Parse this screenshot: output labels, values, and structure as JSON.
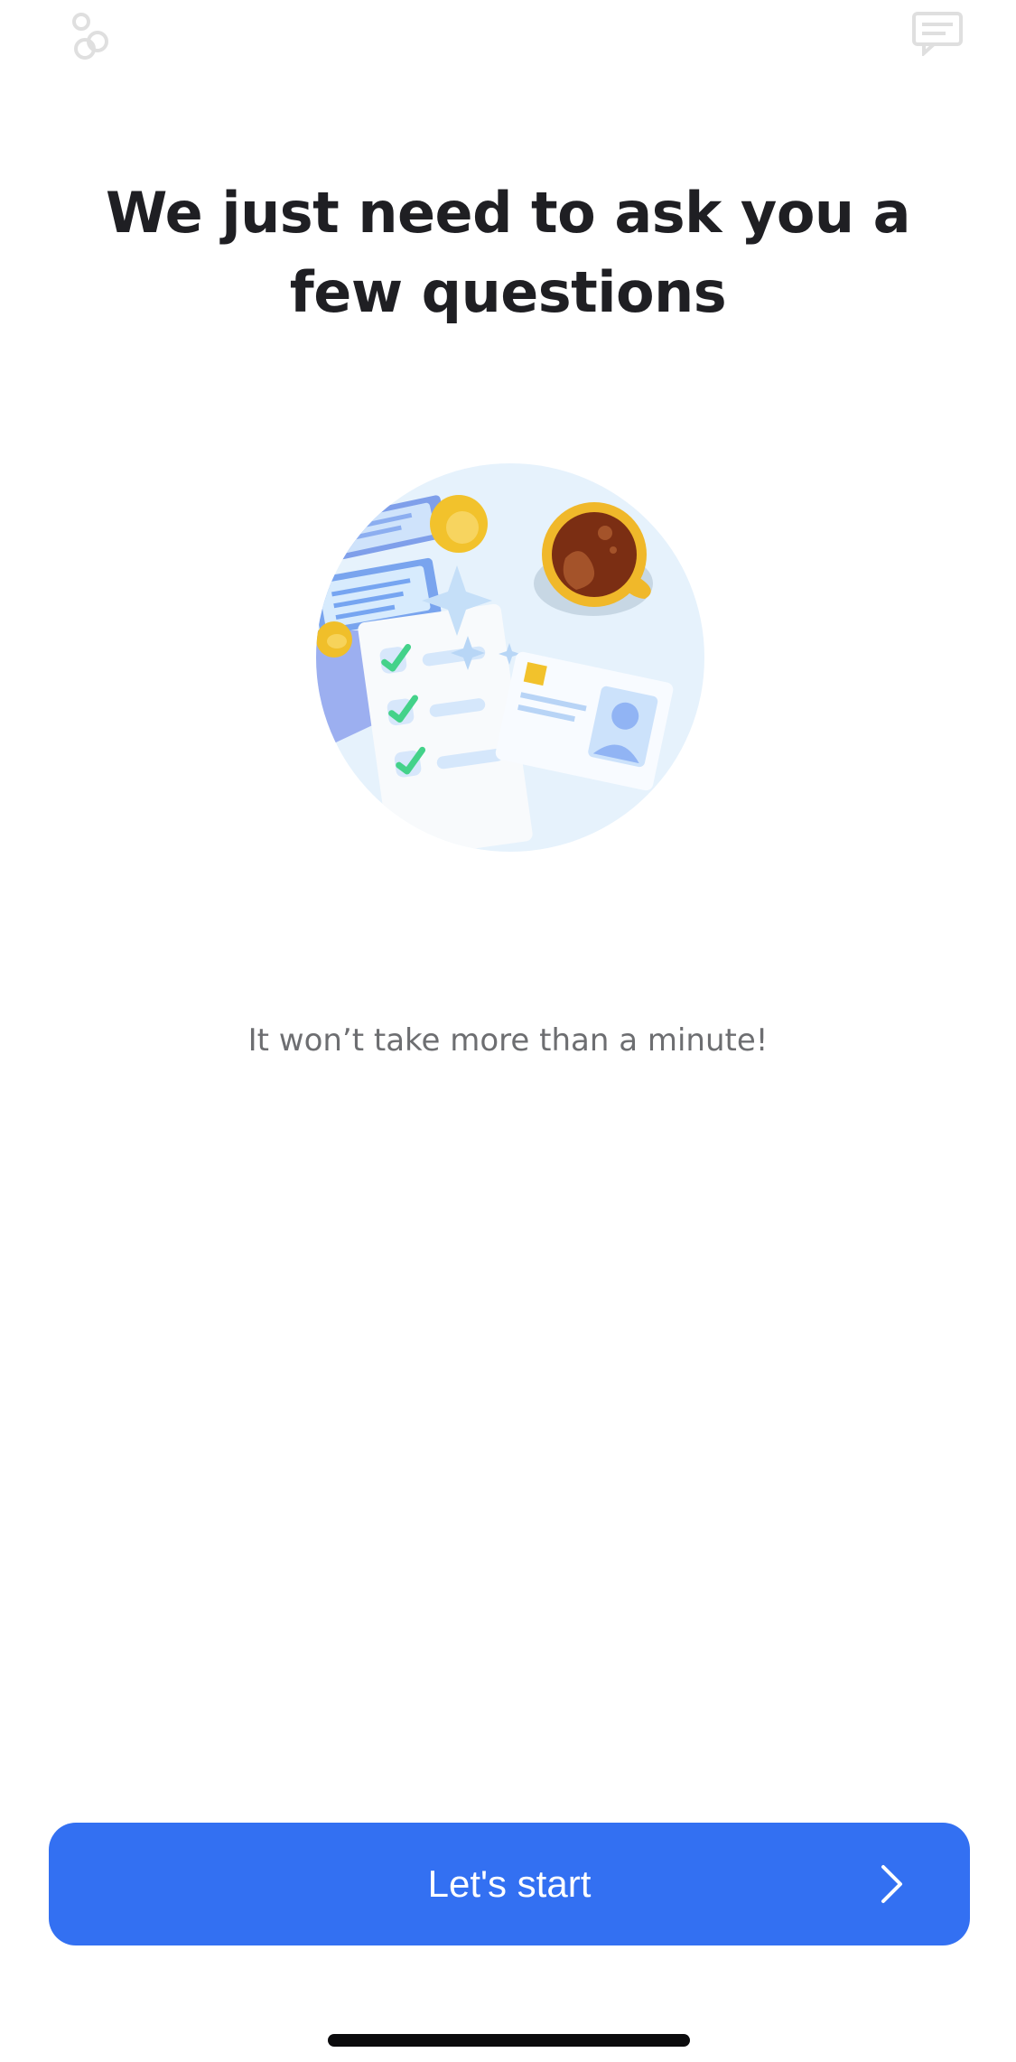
{
  "header": {
    "left_icon": "user-coins-icon",
    "right_icon": "chat-icon"
  },
  "main": {
    "title": "We just need to ask you a few questions",
    "illustration_icon": "checklist-coffee-illustration",
    "subtitle": "It won’t take more than a minute!"
  },
  "footer": {
    "start_button_label": "Let's start",
    "start_button_icon": "chevron-right-icon",
    "start_button_color": "#3370f2"
  },
  "colors": {
    "background": "#ffffff",
    "title": "#1f1f23",
    "subtitle": "#6d6e71",
    "accent": "#3370f2"
  }
}
